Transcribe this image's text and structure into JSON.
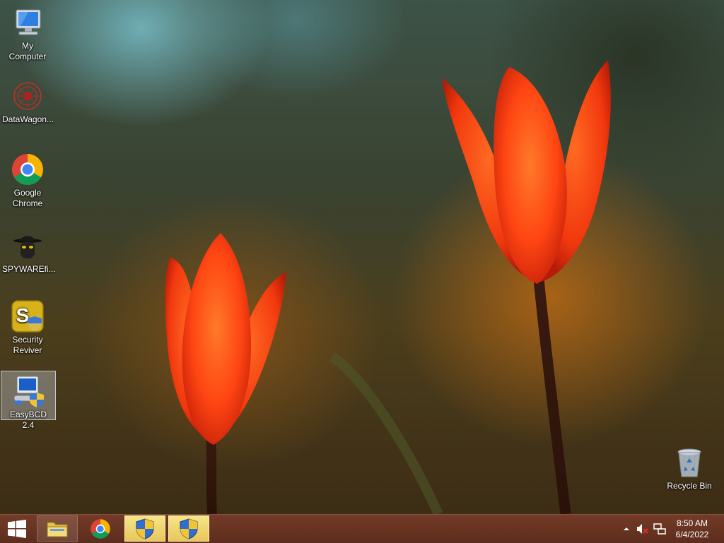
{
  "desktop": {
    "icons": [
      {
        "label": "My Computer"
      },
      {
        "label": "DataWagon..."
      },
      {
        "label": "Google Chrome"
      },
      {
        "label": "SPYWAREfi..."
      },
      {
        "label": "Security Reviver"
      },
      {
        "label": "EasyBCD 2.4"
      },
      {
        "label": "Recycle Bin"
      }
    ]
  },
  "taskbar": {
    "clock": {
      "time": "8:50 AM",
      "date": "6/4/2022"
    }
  },
  "colors": {
    "taskbar": "#6e3523",
    "active_button": "#f0d470",
    "tulip": "#ff4a14"
  }
}
